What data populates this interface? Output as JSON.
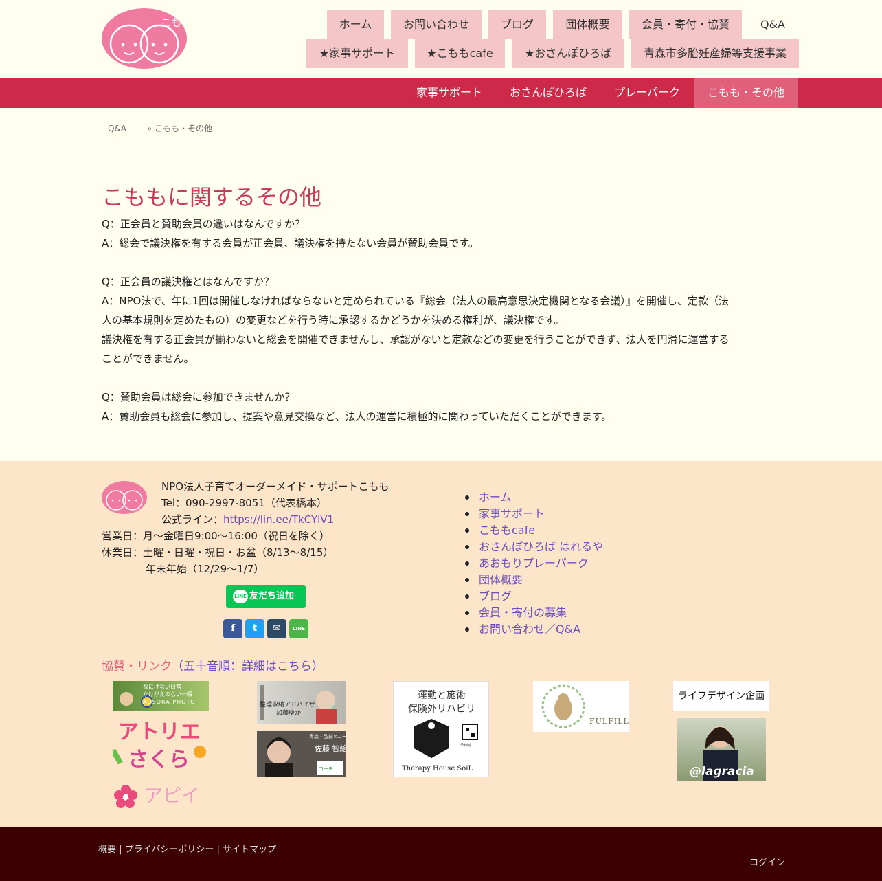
{
  "header": {
    "logo_text": "こもも",
    "nav_row1": [
      "ホーム",
      "お問い合わせ",
      "ブログ",
      "団体概要",
      "会員・寄付・協賛",
      "Q&A"
    ],
    "nav_row2": [
      "★家事サポート",
      "★こももcafe",
      "★おさんぽひろば",
      "青森市多胎妊産婦等支援事業"
    ]
  },
  "subnav": {
    "items": [
      "家事サポート",
      "おさんぽひろば",
      "プレーパーク",
      "こもも・その他"
    ],
    "active_index": 3,
    "accent_color": "#cd2a49"
  },
  "breadcrumb": {
    "items": [
      "Q&A",
      "» こもも・その他"
    ]
  },
  "main": {
    "title": "こももに関するその他",
    "paragraphs": [
      "Q：正会員と賛助会員の違いはなんですか？",
      "A：総会で議決権を有する会員が正会員、議決権を持たない会員が賛助会員です。",
      "",
      "Q：正会員の議決権とはなんですか？",
      "A：NPO法で、年に1回は開催しなければならないと定められている『総会（法人の最高意思決定機関となる会議）』を開催し、定款（法",
      "人の基本規則を定めたもの）の変更などを行う時に承認するかどうかを決める権利が、議決権です。",
      "議決権を有する正会員が揃わないと総会を開催できませんし、承認がないと定款などの変更を行うことができず、法人を円滑に運営する",
      "ことができません。",
      "",
      "Q：賛助会員は総会に参加できませんか？",
      "A：賛助会員も総会に参加し、提案や意見交換など、法人の運営に積極的に関わっていただくことができます。"
    ]
  },
  "footer": {
    "org_name": "NPO法人子育てオーダーメイド・サポートこもも",
    "tel": "Tel：090-2997-8051（代表橋本）",
    "line_label": "公式ライン：",
    "line_url": "https://lin.ee/TkCYlV1",
    "open_days": "営業日：月〜金曜日9:00〜16:00（祝日を除く）",
    "closed_days": "休業日：土曜・日曜・祝日・お盆（8/13〜8/15）",
    "closed_days2": "年末年始（12/29〜1/7）",
    "line_button": "友だち追加",
    "line_badge": "LINE",
    "share_buttons": [
      {
        "icon": "facebook-icon",
        "glyph": "f",
        "color": "#3b5998"
      },
      {
        "icon": "twitter-icon",
        "glyph": "t",
        "color": "#1da1f2"
      },
      {
        "icon": "mail-icon",
        "glyph": "✉",
        "color": "#2c4a66"
      },
      {
        "icon": "line-icon",
        "glyph": "LINE",
        "color": "#4cb648"
      }
    ],
    "nav": [
      "ホーム",
      "家事サポート",
      "こももcafe",
      "おさんぽひろば はれるや",
      "あおもりプレーパーク",
      "団体概要",
      "ブログ",
      "会員・寄付の募集",
      "お問い合わせ／Q&A"
    ],
    "sponsor_heading": "協賛・リンク",
    "sponsor_link": "（五十音順：詳細はこちら）",
    "sponsors": {
      "aosora": {
        "line1": "なにげない日常",
        "line2": "かけがえのない一瞬",
        "line3": "AOSORA PHOTO"
      },
      "atelier": {
        "line1": "アトリエ",
        "line2": "さくら"
      },
      "apii": "アピイ",
      "seiri": {
        "line1": "整理収納アドバイザー",
        "line2": "加藤ゆか"
      },
      "sato": {
        "line1": "青森・弘前×コーチング",
        "line2": "佐藤 智絵",
        "badge": "コーチ"
      },
      "soil": {
        "line1": "運動と施術",
        "line2": "保険外リハビリ",
        "line3": "Therapy House SoiL",
        "small": "予約制"
      },
      "fulfill": "FULFILL",
      "lifedesign": "ライフデザイン企画",
      "lagracia": "@lagracia"
    }
  },
  "bottom": {
    "links": [
      "概要",
      "プライバシーポリシー",
      "サイトマップ"
    ],
    "separator": " | ",
    "login": "ログイン"
  }
}
